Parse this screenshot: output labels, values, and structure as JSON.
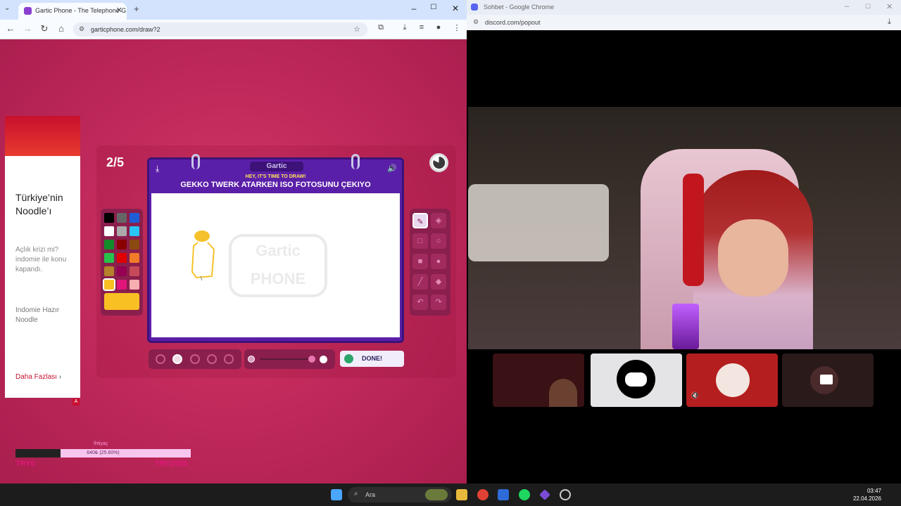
{
  "browser": {
    "tab_title": "Gartic Phone - The Telephone G",
    "new_tab": "+",
    "url": "garticphone.com/draw?2",
    "win_min": "–",
    "win_max": "☐",
    "win_close": "✕"
  },
  "ad": {
    "headline": "Türkiye’nin Noodle’ı",
    "body": "Açlık krizi mi? indomie ile konu kapandı.",
    "product": "Indomie Hazır Noodle",
    "more": "Daha Fazlası",
    "tag": "A"
  },
  "game": {
    "round": "2/5",
    "logo": "Gartic",
    "hey": "HEY, IT'S TIME TO DRAW!",
    "prompt": "GEKKO TWERK ATARKEN ISO FOTOSUNU ÇEKIYO",
    "done": "DONE!",
    "watermark": "Gartic PHONE",
    "selected_color": "#f8c023",
    "palette": [
      "#000000",
      "#666666",
      "#1f5dd6",
      "#ffffff",
      "#aaaaaa",
      "#29c5f6",
      "#128c2a",
      "#8b0000",
      "#8a4a10",
      "#27c24a",
      "#e00000",
      "#f07b28",
      "#b5812a",
      "#960052",
      "#c64a5a",
      "#f8c023",
      "#e0147a",
      "#f7aeb0"
    ]
  },
  "goal": {
    "title": "İhtiyaç",
    "progress_text": "640₺ (25.60%)",
    "progress_fraction": 0.256,
    "min": "TRY0",
    "max": "TRY2500"
  },
  "discord": {
    "title": "Sohbet - Google Chrome",
    "url": "discord.com/popout"
  },
  "taskbar": {
    "search": "Ara",
    "time": "03:47",
    "date": "22.04.2026"
  }
}
